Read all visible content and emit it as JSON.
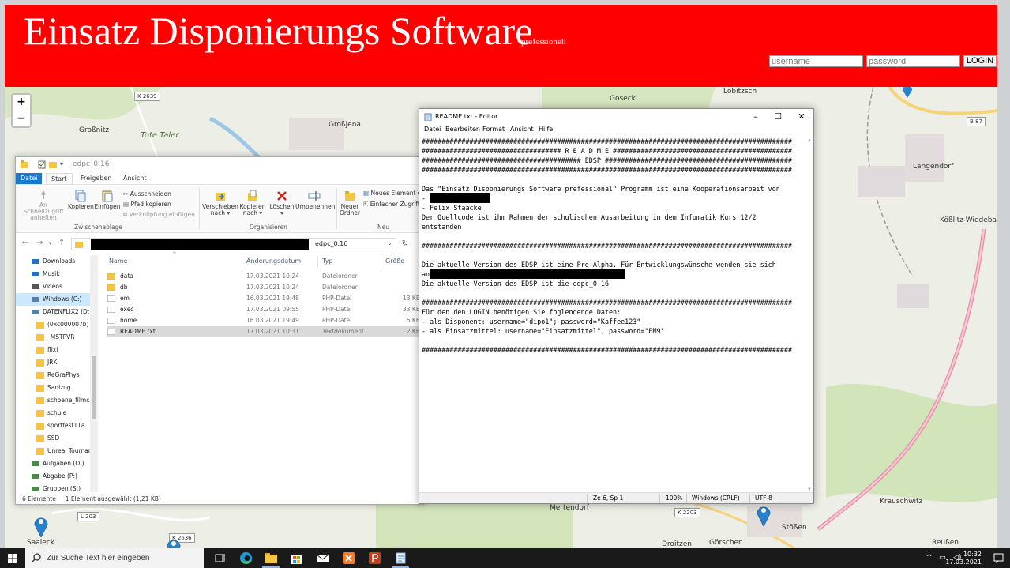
{
  "header": {
    "title": "Einsatz Disponierungs Software",
    "subtitle": "professionell",
    "username_placeholder": "username",
    "password_placeholder": "password",
    "login_label": "LOGIN",
    "bg_color": "#ff0000"
  },
  "map": {
    "zoom_in": "+",
    "zoom_out": "−",
    "labels": {
      "k2639": "K 2639",
      "grossnitz": "Großnitz",
      "tote_taler": "Tote Taler",
      "grossjena": "Großjena",
      "goseck": "Goseck",
      "lobitzsch": "Lobitzsch",
      "b87": "B 87",
      "langendorf": "Langendorf",
      "koesslitz": "Kößlitz-Wiedebach",
      "l203": "L 203",
      "saaleck": "Saaleck",
      "k2636": "K 2636",
      "mertendorf": "Mertendorf",
      "k2203": "K 2203",
      "krauschwitz": "Krauschwitz",
      "stoessen": "Stößen",
      "droitzen": "Droitzen",
      "goerschen": "Görschen",
      "reussen": "Reußen"
    }
  },
  "explorer": {
    "path_title": "edpc_0.16",
    "tabs": {
      "file": "Datei",
      "start": "Start",
      "share": "Freigeben",
      "view": "Ansicht"
    },
    "ribbon": {
      "pin": "An Schnellzugriff anheften",
      "copy": "Kopieren",
      "paste": "Einfügen",
      "cut": "Ausschneiden",
      "copy_path": "Pfad kopieren",
      "paste_shortcut": "Verknüpfung einfügen",
      "group_clipboard": "Zwischenablage",
      "move_to": "Verschieben nach",
      "copy_to": "Kopieren nach",
      "delete": "Löschen",
      "rename": "Umbenennen",
      "group_organize": "Organisieren",
      "new_folder": "Neuer Ordner",
      "new_item": "Neues Element",
      "easy_access": "Einfacher Zugriff",
      "group_new": "Neu"
    },
    "address": "edpc_0.16",
    "nav": [
      {
        "label": "Downloads",
        "icon": "download-icon"
      },
      {
        "label": "Musik",
        "icon": "music-icon"
      },
      {
        "label": "Videos",
        "icon": "video-icon"
      },
      {
        "label": "Windows (C:)",
        "icon": "drive-icon"
      },
      {
        "label": "DATENFLIX2 (D:)",
        "icon": "drive-icon"
      },
      {
        "label": "(0xc000007b)",
        "icon": "folder-icon"
      },
      {
        "label": "_MSTPVR",
        "icon": "folder-icon"
      },
      {
        "label": "flixi",
        "icon": "folder-icon"
      },
      {
        "label": "JRK",
        "icon": "folder-icon"
      },
      {
        "label": "ReGraPhys",
        "icon": "folder-icon"
      },
      {
        "label": "Sanizug",
        "icon": "folder-icon"
      },
      {
        "label": "schoene_filmcl",
        "icon": "folder-icon"
      },
      {
        "label": "schule",
        "icon": "folder-icon"
      },
      {
        "label": "sportfest11a",
        "icon": "folder-icon"
      },
      {
        "label": "SSD",
        "icon": "folder-icon"
      },
      {
        "label": "Unreal Tournar",
        "icon": "folder-icon"
      },
      {
        "label": "Aufgaben (O:)",
        "icon": "network-drive-icon"
      },
      {
        "label": "Abgabe (P:)",
        "icon": "network-drive-icon"
      },
      {
        "label": "Gruppen (S:)",
        "icon": "network-drive-icon"
      }
    ],
    "columns": {
      "name": "Name",
      "date": "Änderungsdatum",
      "type": "Typ",
      "size": "Größe"
    },
    "files": [
      {
        "name": "data",
        "date": "17.03.2021 10:24",
        "type": "Dateiordner",
        "size": "",
        "icon": "folder-icon"
      },
      {
        "name": "db",
        "date": "17.03.2021 10:24",
        "type": "Dateiordner",
        "size": "",
        "icon": "folder-icon"
      },
      {
        "name": "em",
        "date": "16.03.2021 19:48",
        "type": "PHP-Datei",
        "size": "13 KB",
        "icon": "php-file-icon"
      },
      {
        "name": "exec",
        "date": "17.03.2021 09:55",
        "type": "PHP-Datei",
        "size": "33 KB",
        "icon": "php-file-icon"
      },
      {
        "name": "home",
        "date": "16.03.2021 19:49",
        "type": "PHP-Datei",
        "size": "6 KB",
        "icon": "php-file-icon"
      },
      {
        "name": "README.txt",
        "date": "17.03.2021 10:31",
        "type": "Textdokument",
        "size": "2 KB",
        "icon": "text-file-icon"
      }
    ],
    "status_count": "6 Elemente",
    "status_selected": "1 Element ausgewählt (1,21 KB)"
  },
  "notepad": {
    "title": "README.txt - Editor",
    "menu": [
      "Datei",
      "Bearbeiten",
      "Format",
      "Ansicht",
      "Hilfe"
    ],
    "lines": [
      "#############################################################################################",
      "################################### R E A D M E #############################################",
      "######################################## EDSP ###############################################",
      "#############################################################################################",
      "",
      "Das \"Einsatz Disponierungs Software prefessional\" Programm ist eine Kooperationsarbeit von",
      "-",
      "- Felix Staacke",
      "Der Quellcode ist ihm Rahmen der schulischen Ausarbeitung in dem Infomatik Kurs 12/2",
      "entstanden",
      "",
      "#############################################################################################",
      "",
      "Die aktuelle Version des EDSP ist eine Pre-Alpha. Für Entwicklungswünsche wenden sie sich",
      "an",
      "Die aktuelle Version des EDSP ist die edpc_0.16",
      "",
      "#############################################################################################",
      "Für den den LOGIN benötigen Sie foglendende Daten:",
      "- als Disponent: username=\"dipo1\"; password=\"Kaffee123\"",
      "- als Einsatzmittel: username=\"Einsatzmittel\"; password=\"EM9\"",
      "",
      "#############################################################################################"
    ],
    "status": {
      "position": "Ze 6, Sp 1",
      "zoom": "100%",
      "line_endings": "Windows (CRLF)",
      "encoding": "UTF-8"
    }
  },
  "taskbar": {
    "search_placeholder": "Zur Suche Text hier eingeben",
    "time": "10:32",
    "date": "17.03.2021"
  }
}
